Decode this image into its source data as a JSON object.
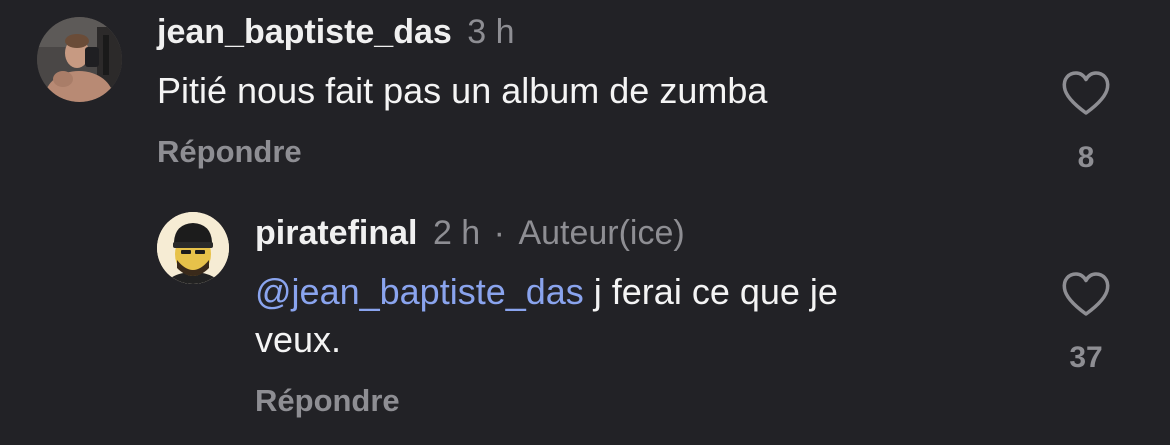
{
  "comments": [
    {
      "username": "jean_baptiste_das",
      "time": "3 h",
      "text": "Pitié nous fait pas un album de zumba",
      "reply_label": "Répondre",
      "likes": "8"
    },
    {
      "username": "piratefinal",
      "time": "2 h",
      "separator": "·",
      "author_badge": "Auteur(ice)",
      "mention": "@jean_baptiste_das",
      "text_line1": " j ferai ce que je",
      "text_line2": "veux.",
      "reply_label": "Répondre",
      "likes": "37"
    }
  ],
  "icons": {
    "like": "heart-outline-icon"
  },
  "colors": {
    "background": "#222226",
    "mention": "#8aa4ee",
    "meta": "#8e8e93"
  }
}
